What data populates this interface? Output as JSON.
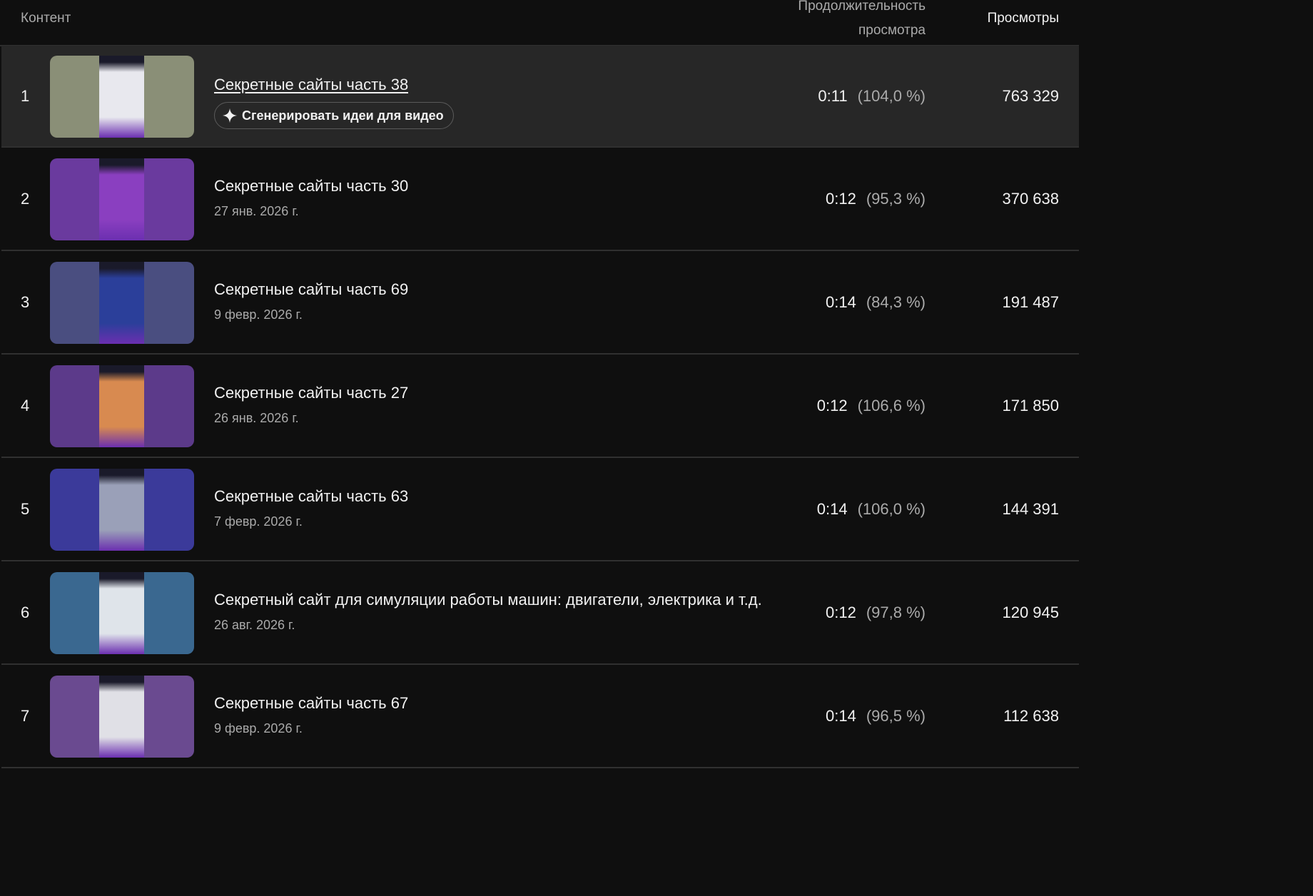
{
  "header": {
    "content_label": "Контент",
    "duration_label_line1": "Продолжительность",
    "duration_label_line2": "просмотра",
    "views_label": "Просмотры"
  },
  "generate_button_label": "Сгенерировать идеи для видео",
  "rows": [
    {
      "index": "1",
      "title": "Секретные сайты часть 38",
      "date": "",
      "duration": "0:11",
      "percent": "(104,0 %)",
      "views": "763 329",
      "thumb_bg": "#8a8f77",
      "thumb_fg": "#e8e8ee"
    },
    {
      "index": "2",
      "title": "Секретные сайты часть 30",
      "date": "27 янв. 2026 г.",
      "duration": "0:12",
      "percent": "(95,3 %)",
      "views": "370 638",
      "thumb_bg": "#6a3a9e",
      "thumb_fg": "#8a3fc0"
    },
    {
      "index": "3",
      "title": "Секретные сайты часть 69",
      "date": "9 февр. 2026 г.",
      "duration": "0:14",
      "percent": "(84,3 %)",
      "views": "191 487",
      "thumb_bg": "#4a4e80",
      "thumb_fg": "#2b3f9a"
    },
    {
      "index": "4",
      "title": "Секретные сайты часть 27",
      "date": "26 янв. 2026 г.",
      "duration": "0:12",
      "percent": "(106,6 %)",
      "views": "171 850",
      "thumb_bg": "#5c3a8a",
      "thumb_fg": "#d88a50"
    },
    {
      "index": "5",
      "title": "Секретные сайты часть 63",
      "date": "7 февр. 2026 г.",
      "duration": "0:14",
      "percent": "(106,0 %)",
      "views": "144 391",
      "thumb_bg": "#3b3a9a",
      "thumb_fg": "#9aa0b8"
    },
    {
      "index": "6",
      "title": "Секретный сайт для симуляции работы машин: двигатели, электрика и т.д.",
      "date": "26 авг. 2026 г.",
      "duration": "0:12",
      "percent": "(97,8 %)",
      "views": "120 945",
      "thumb_bg": "#3a6890",
      "thumb_fg": "#dfe4ea"
    },
    {
      "index": "7",
      "title": "Секретные сайты часть 67",
      "date": "9 февр. 2026 г.",
      "duration": "0:14",
      "percent": "(96,5 %)",
      "views": "112 638",
      "thumb_bg": "#6a4a90",
      "thumb_fg": "#e0e0e6"
    }
  ]
}
